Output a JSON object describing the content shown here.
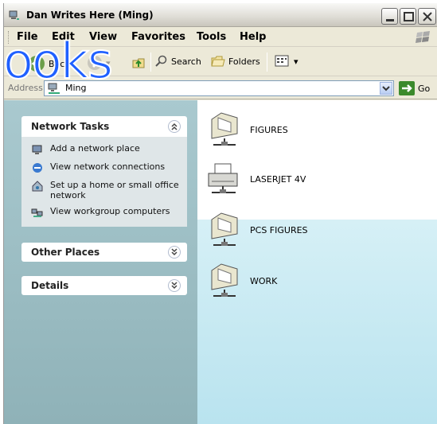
{
  "window": {
    "title": "Dan Writes Here (Ming)"
  },
  "menubar": {
    "items": [
      "File",
      "Edit",
      "View",
      "Favorites",
      "Tools",
      "Help"
    ]
  },
  "toolbar": {
    "back_label": "Back",
    "search_label": "Search",
    "folders_label": "Folders"
  },
  "address": {
    "label": "Address",
    "value": "Ming",
    "go_label": "Go"
  },
  "tasks": {
    "network_tasks_title": "Network Tasks",
    "items": [
      "Add a network place",
      "View network connections",
      "Set up a home or small office network",
      "View workgroup computers"
    ],
    "other_places_title": "Other Places",
    "details_title": "Details"
  },
  "files": [
    {
      "name": "FIGURES",
      "icon": "shared-folder-icon"
    },
    {
      "name": "LASERJET 4V",
      "icon": "printer-icon"
    },
    {
      "name": "PCS FIGURES",
      "icon": "shared-folder-icon"
    },
    {
      "name": "WORK",
      "icon": "shared-folder-icon"
    }
  ],
  "overlay": {
    "text": "ooks"
  },
  "colors": {
    "overlay_blue": "#1f60ff",
    "pane_bg": "#8fb2b8",
    "content_teal": "#b9e3ef"
  }
}
